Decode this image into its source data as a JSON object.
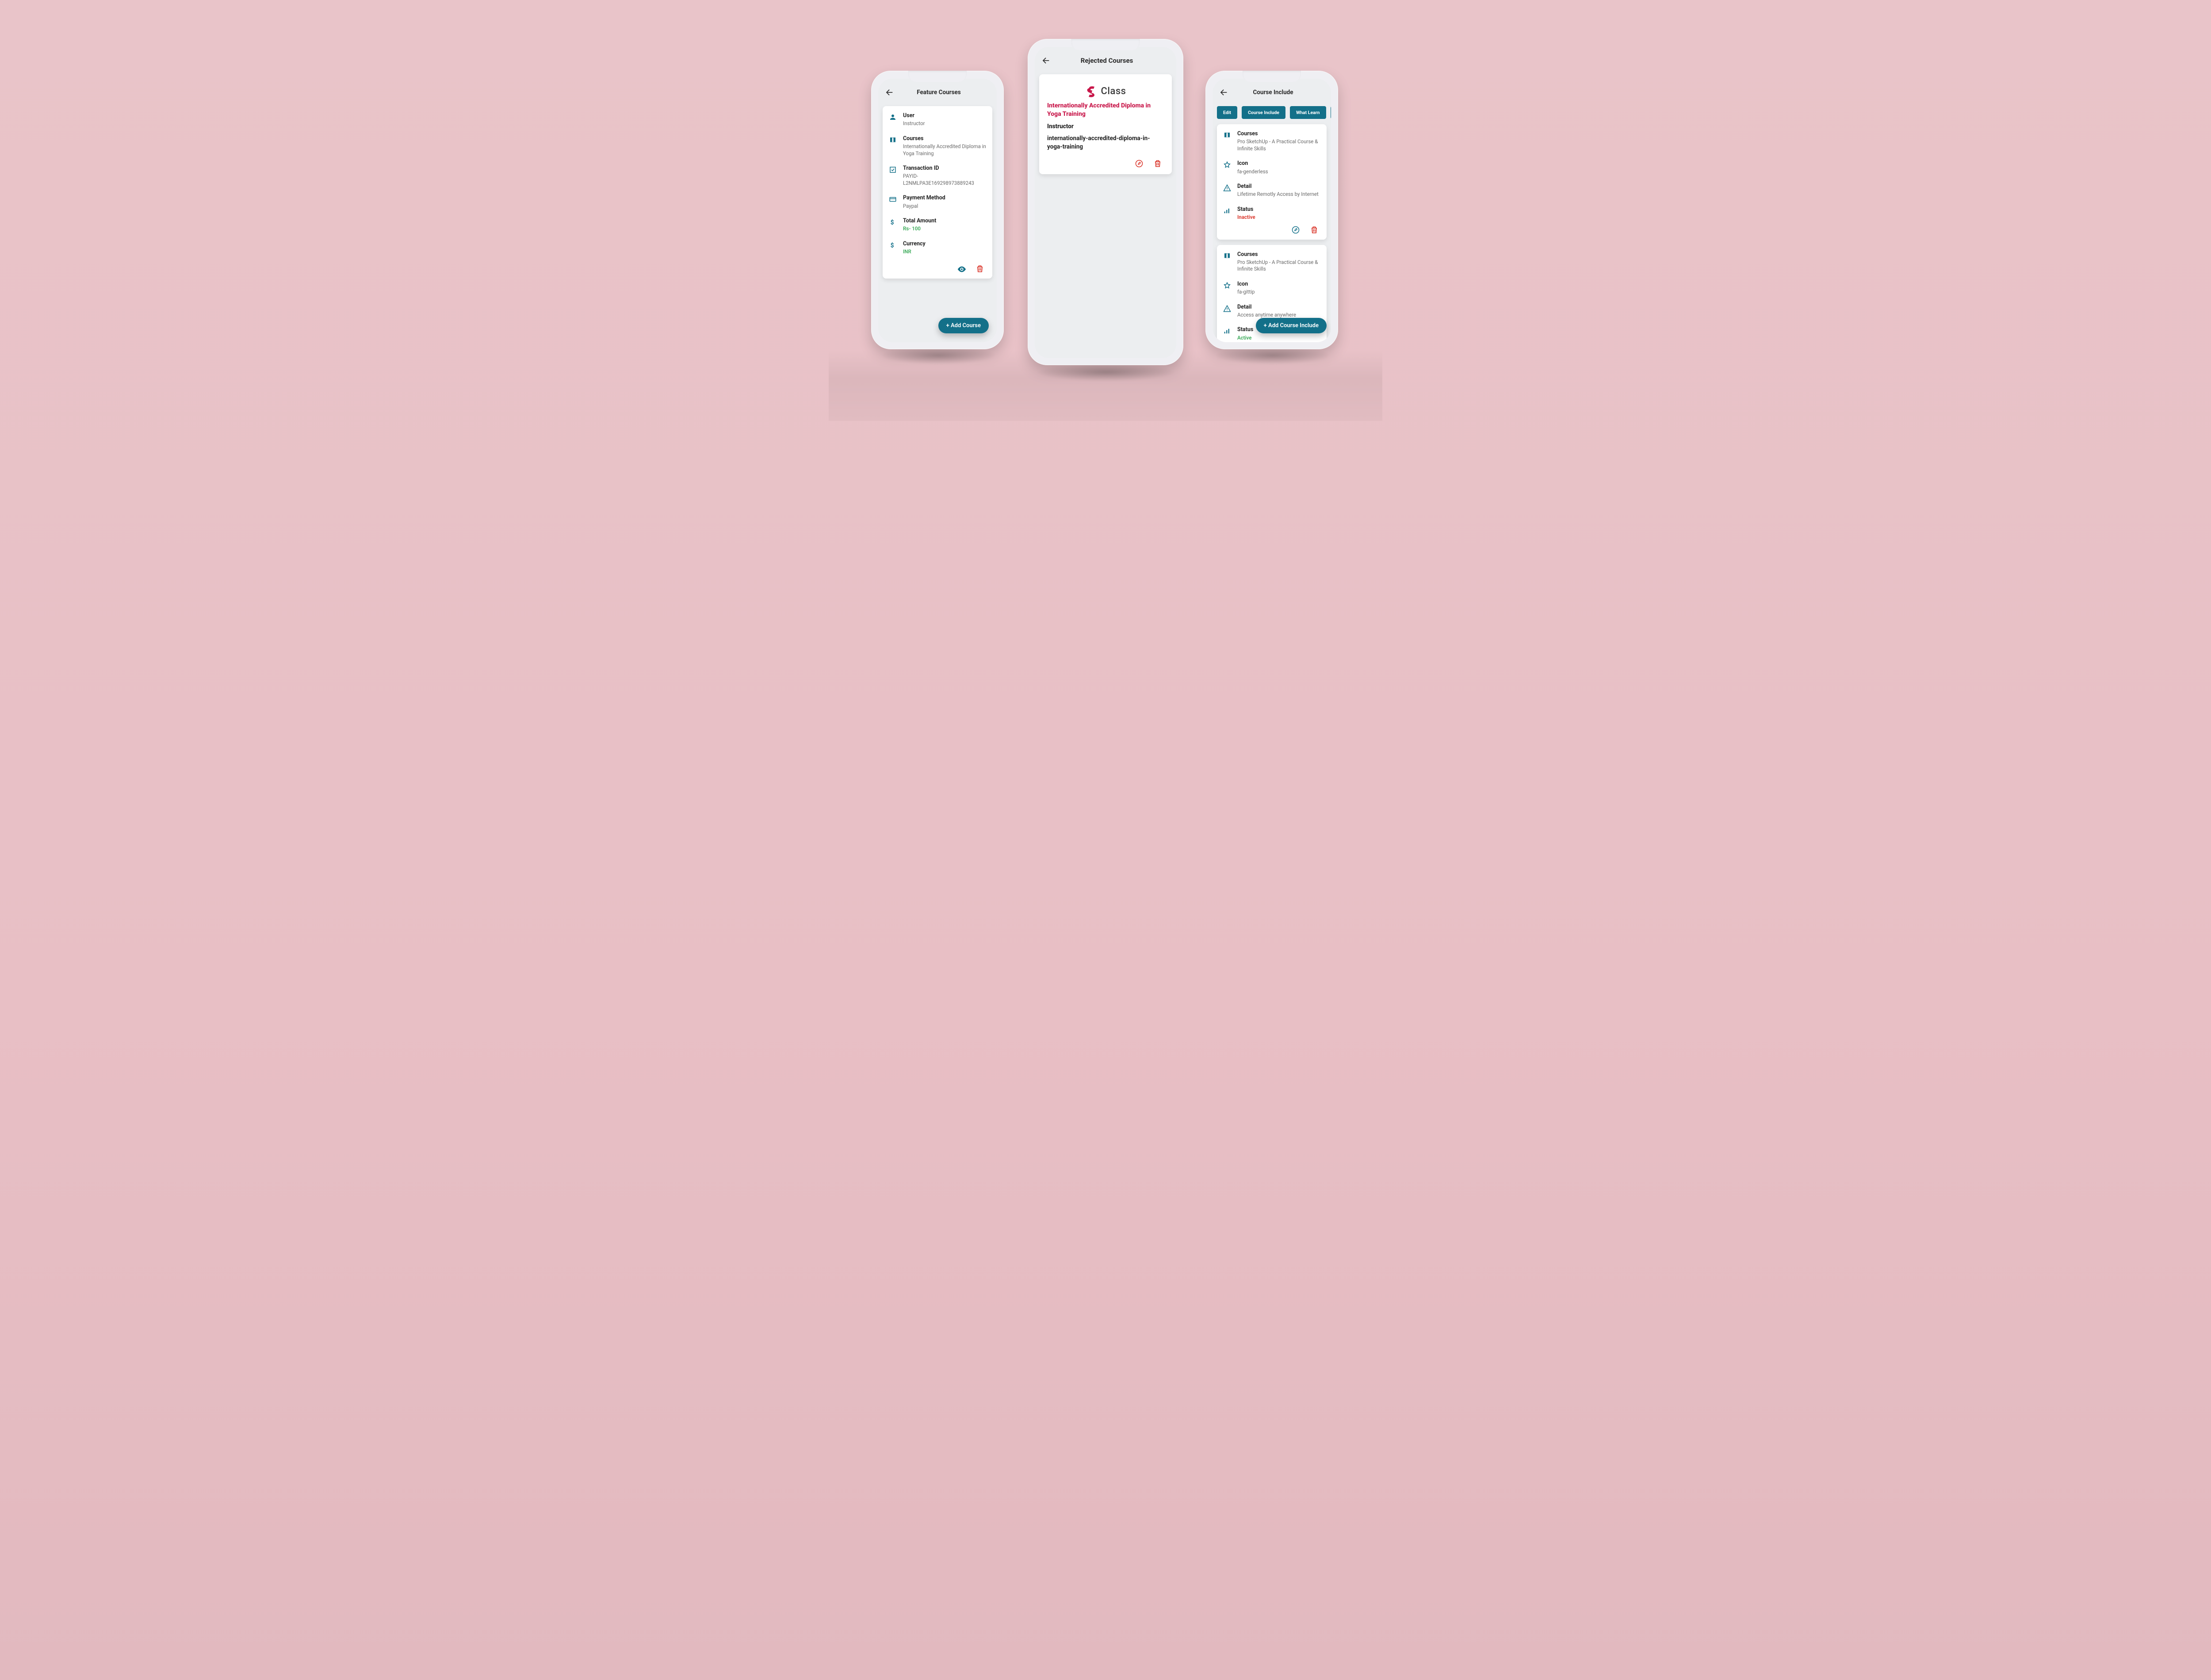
{
  "left": {
    "title": "Feature Courses",
    "rows": [
      {
        "label": "User",
        "value": "Instructor",
        "icon": "person-icon"
      },
      {
        "label": "Courses",
        "value": "Internationally Accredited Diploma in Yoga Training",
        "icon": "book-icon"
      },
      {
        "label": "Transaction ID",
        "value": "PAYID-L2NMLPA3E169298973889243",
        "icon": "check-square-icon"
      },
      {
        "label": "Payment Method",
        "value": "Paypal",
        "icon": "credit-card-icon"
      },
      {
        "label": "Total Amount",
        "value": "Rs- 100",
        "icon": "dollar-icon",
        "variant": "green"
      },
      {
        "label": "Currency",
        "value": "INR",
        "icon": "dollar-icon",
        "variant": "green"
      }
    ],
    "fab": "+ Add Course"
  },
  "center": {
    "title": "Rejected Courses",
    "brand": "Class",
    "course_title": "Internationally Accredited Diploma in Yoga Training",
    "role": "Instructor",
    "slug": "internationally-accredited-diploma-in-yoga-training"
  },
  "right": {
    "title": "Course Include",
    "tabs": [
      "Edit",
      "Course Include",
      "What Learn"
    ],
    "cards": [
      {
        "rows": [
          {
            "label": "Courses",
            "value": "Pro SketchUp  - A Practical Course & Infinite Skills",
            "icon": "book-icon"
          },
          {
            "label": "Icon",
            "value": "fa-genderless",
            "icon": "star-icon"
          },
          {
            "label": "Detail",
            "value": "Lifetime Remotly Access by Internet",
            "icon": "alert-icon"
          },
          {
            "label": "Status",
            "value": "Inactive",
            "icon": "bars-icon",
            "variant": "red"
          }
        ]
      },
      {
        "rows": [
          {
            "label": "Courses",
            "value": "Pro SketchUp  - A Practical Course & Infinite Skills",
            "icon": "book-icon"
          },
          {
            "label": "Icon",
            "value": "fa-gittip",
            "icon": "star-icon"
          },
          {
            "label": "Detail",
            "value": "Access anytime anywhere",
            "icon": "alert-icon"
          },
          {
            "label": "Status",
            "value": "Active",
            "icon": "bars-icon",
            "variant": "green"
          }
        ]
      }
    ],
    "fab": "+ Add Course Include"
  }
}
